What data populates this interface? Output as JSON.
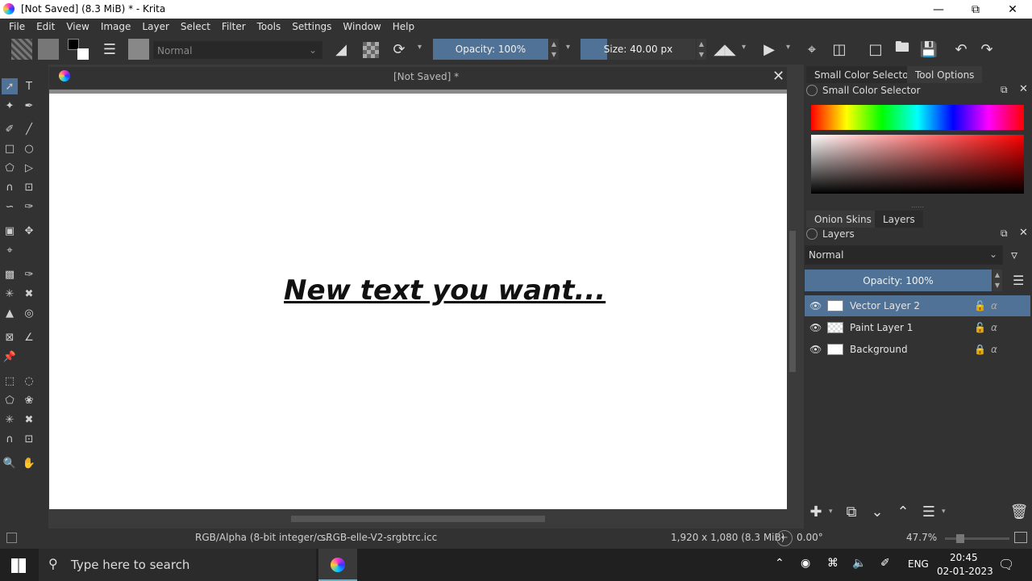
{
  "window": {
    "title": "[Not Saved]  (8.3 MiB)  * - Krita"
  },
  "menu": [
    "File",
    "Edit",
    "View",
    "Image",
    "Layer",
    "Select",
    "Filter",
    "Tools",
    "Settings",
    "Window",
    "Help"
  ],
  "toolbar": {
    "blend_mode": "Normal",
    "opacity_label": "Opacity: 100%",
    "size_label": "Size: 40.00 px"
  },
  "document": {
    "tab_title": "[Not Saved]  *",
    "canvas_text": "New text you want..."
  },
  "docker_top": {
    "tabs": [
      "Small Color Selector",
      "Tool Options"
    ],
    "panel_title": "Small Color Selector"
  },
  "docker_layers": {
    "tabs": [
      "Onion Skins",
      "Layers"
    ],
    "panel_title": "Layers",
    "blend_mode": "Normal",
    "opacity_label": "Opacity:  100%",
    "layers": [
      {
        "name": "Vector Layer 2",
        "selected": true
      },
      {
        "name": "Paint Layer 1",
        "selected": false
      },
      {
        "name": "Background",
        "selected": false
      }
    ]
  },
  "status": {
    "color_model": "RGB/Alpha (8-bit integer/c...",
    "profile": "sRGB-elle-V2-srgbtrc.icc",
    "dimensions": "1,920 x 1,080 (8.3 MiB)",
    "rotation": "0.00°",
    "zoom": "47.7%"
  },
  "taskbar": {
    "search_placeholder": "Type here to search",
    "language": "ENG",
    "time": "20:45",
    "date": "02-01-2023"
  }
}
